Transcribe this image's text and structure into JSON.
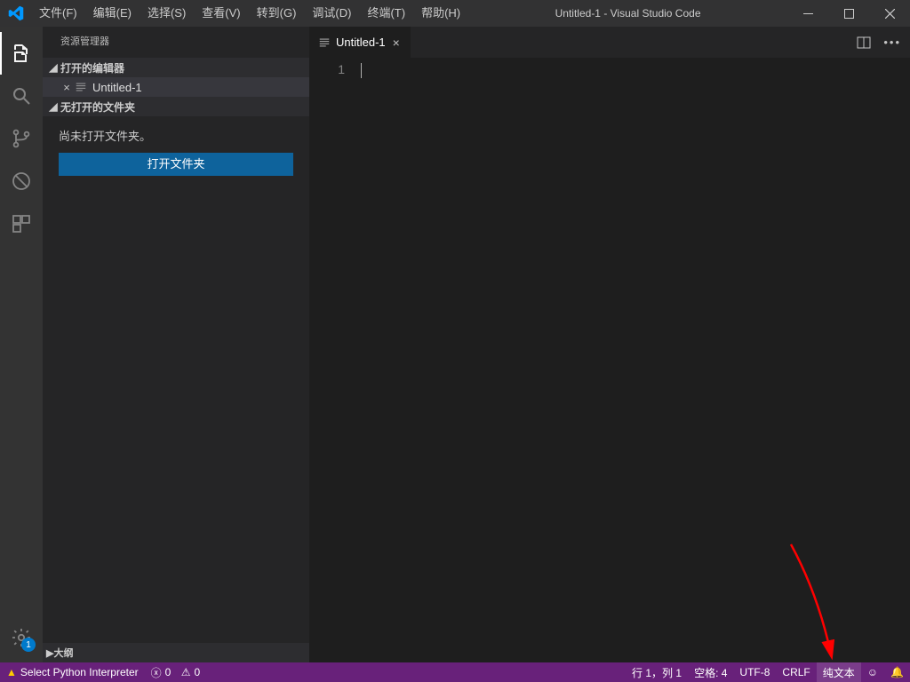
{
  "titlebar": {
    "menus": [
      "文件(F)",
      "编辑(E)",
      "选择(S)",
      "查看(V)",
      "转到(G)",
      "调试(D)",
      "终端(T)",
      "帮助(H)"
    ],
    "title": "Untitled-1 - Visual Studio Code"
  },
  "activitybar": {
    "badge": "1"
  },
  "sidebar": {
    "title": "资源管理器",
    "open_editors_label": "打开的编辑器",
    "open_editor_item": "Untitled-1",
    "no_folder_label": "无打开的文件夹",
    "no_folder_message": "尚未打开文件夹。",
    "open_folder_button": "打开文件夹",
    "outline_label": "大纲"
  },
  "editor": {
    "tab_label": "Untitled-1",
    "line_numbers": [
      "1"
    ]
  },
  "statusbar": {
    "python_interpreter": "Select Python Interpreter",
    "errors": "0",
    "warnings": "0",
    "line_col": "行 1，列 1",
    "spaces": "空格: 4",
    "encoding": "UTF-8",
    "eol": "CRLF",
    "language": "纯文本"
  }
}
